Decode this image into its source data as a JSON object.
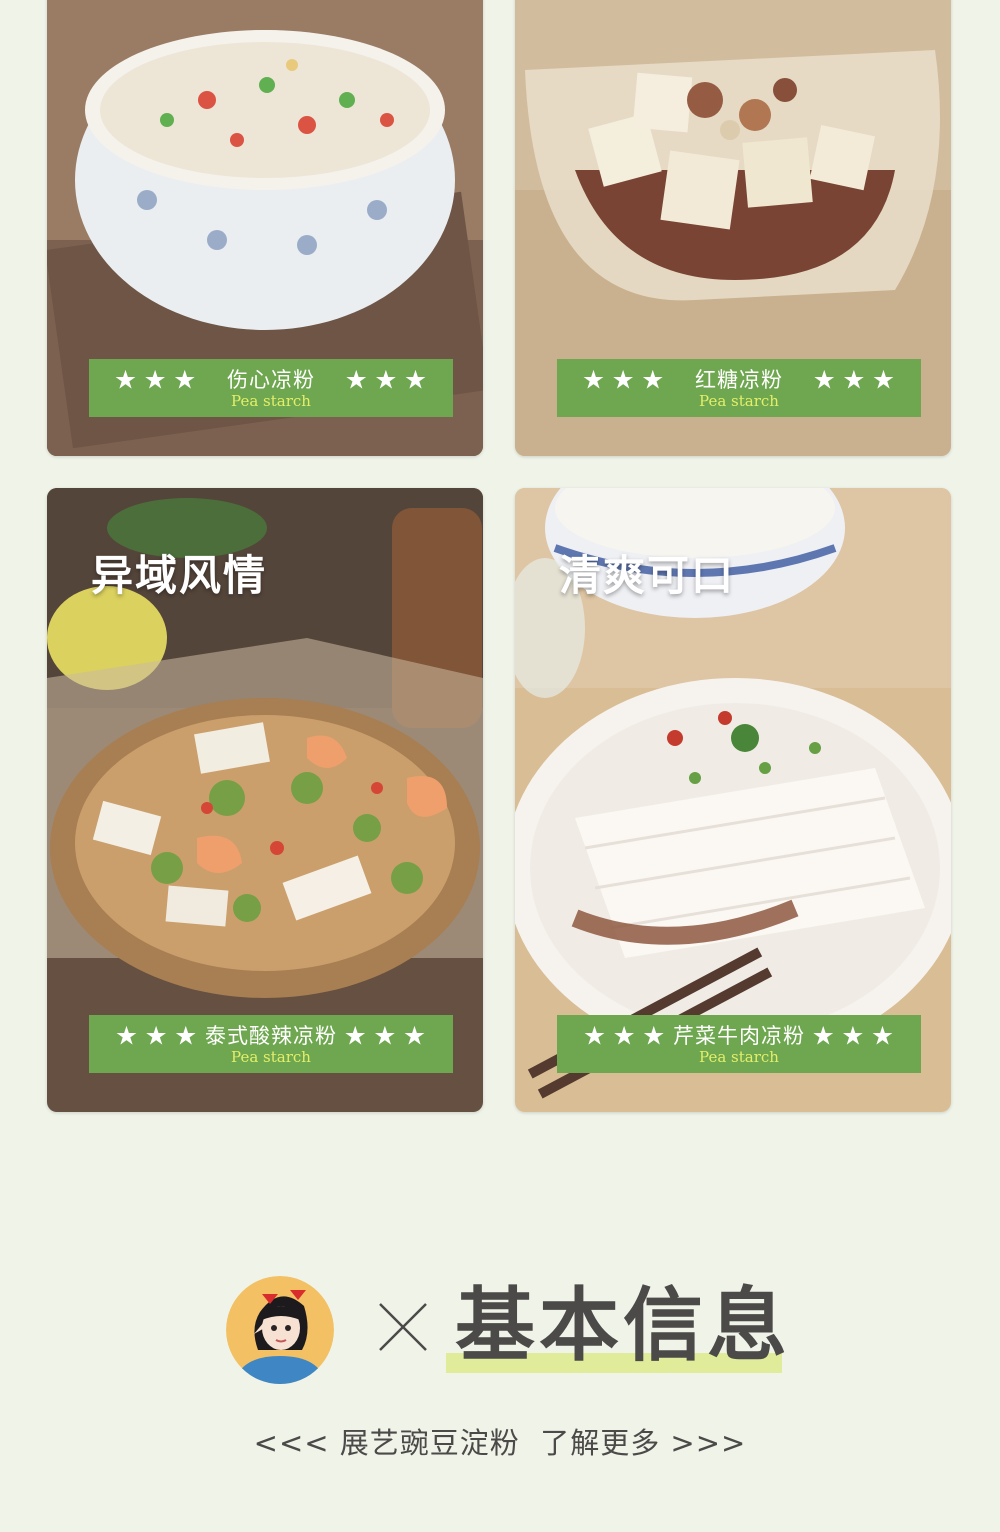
{
  "cards": [
    {
      "name": "伤心凉粉",
      "stars_left": "★ ★ ★",
      "stars_right": "★ ★ ★",
      "subtitle": "Pea starch"
    },
    {
      "name": "红糖凉粉",
      "stars_left": "★ ★ ★",
      "stars_right": "★ ★ ★",
      "subtitle": "Pea starch"
    },
    {
      "name": "泰式酸辣凉粉",
      "stars_left": "★ ★ ★",
      "stars_right": "★ ★ ★",
      "subtitle": "Pea starch",
      "headline": "异域风情"
    },
    {
      "name": "芹菜牛肉凉粉",
      "stars_left": "★ ★ ★",
      "stars_right": "★ ★ ★",
      "subtitle": "Pea starch",
      "headline": "清爽可口"
    }
  ],
  "section": {
    "title": "基本信息"
  },
  "more_link": "<<< 展艺豌豆淀粉  了解更多 >>>",
  "colors": {
    "background": "#eff3e8",
    "banner": "#6ea74f",
    "subtitle": "#e4ee6a",
    "accent_underline": "#e0ec9a",
    "title": "#4b4a48"
  },
  "icons": [
    "avatar-illustration",
    "times-icon"
  ]
}
